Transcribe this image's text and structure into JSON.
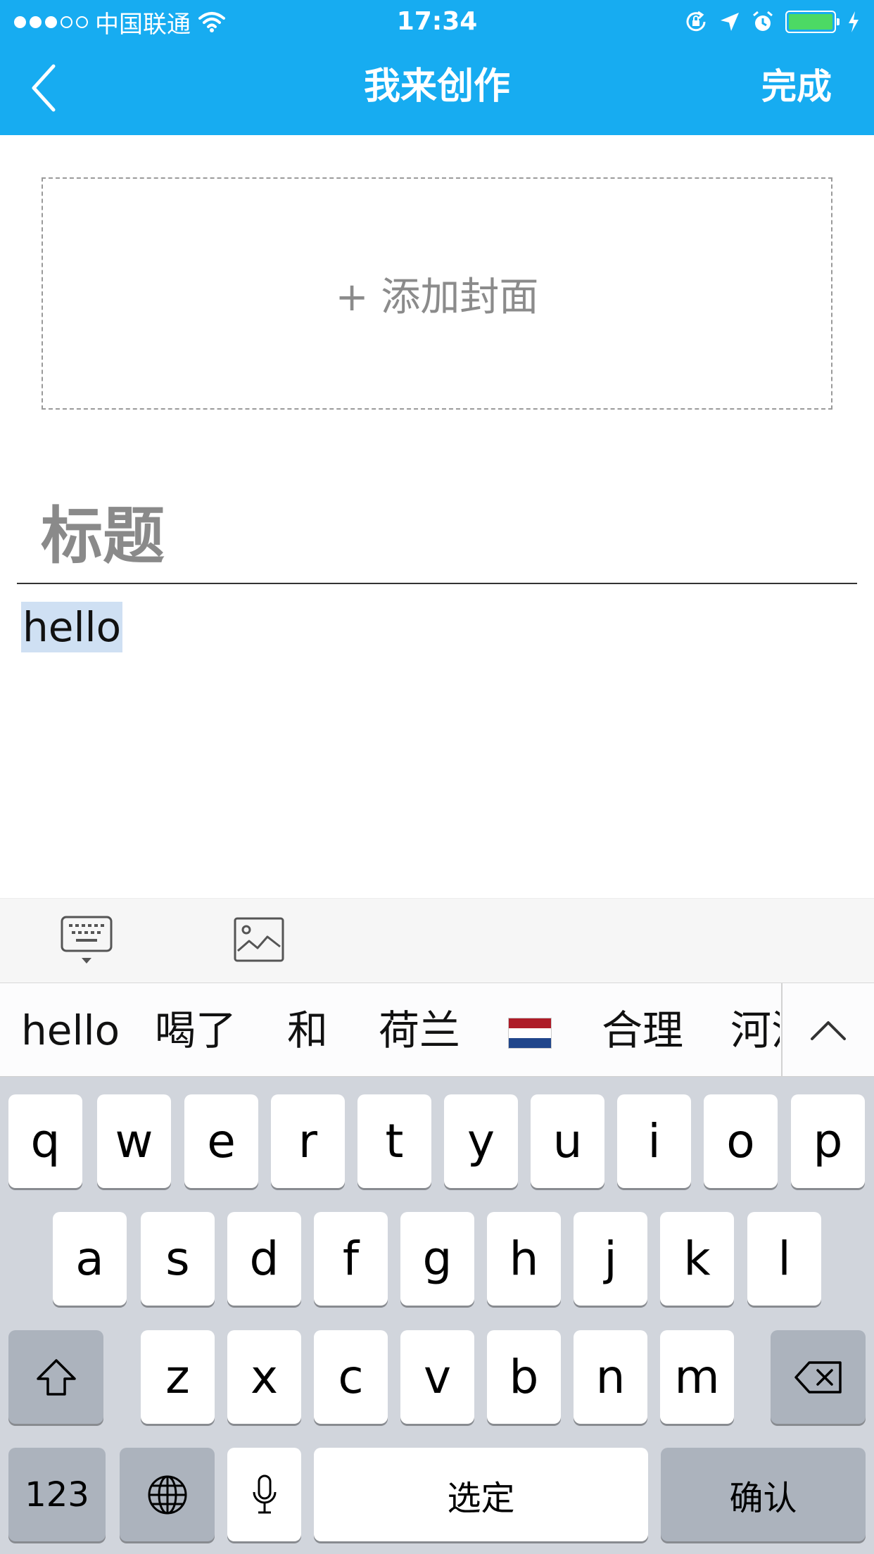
{
  "status_bar": {
    "carrier": "中国联通",
    "time": "17:34",
    "signal_bars_filled": 3,
    "signal_bars_total": 5,
    "battery_level": 1.0
  },
  "nav": {
    "title": "我来创作",
    "done_label": "完成"
  },
  "editor": {
    "cover_label": "+ 添加封面",
    "title_placeholder": "标题",
    "body_text": "hello"
  },
  "toolbar": {
    "icons": [
      "keyboard-toggle-icon",
      "insert-image-icon"
    ]
  },
  "candidates": {
    "items": [
      "hello",
      "喝了",
      "和",
      "荷兰",
      "🇳🇱",
      "合理",
      "河流"
    ]
  },
  "keyboard": {
    "row1": [
      "q",
      "w",
      "e",
      "r",
      "t",
      "y",
      "u",
      "i",
      "o",
      "p"
    ],
    "row2": [
      "a",
      "s",
      "d",
      "f",
      "g",
      "h",
      "j",
      "k",
      "l"
    ],
    "row3": [
      "z",
      "x",
      "c",
      "v",
      "b",
      "n",
      "m"
    ],
    "numbers_label": "123",
    "space_label": "选定",
    "return_label": "确认"
  },
  "colors": {
    "header": "#17acf1",
    "keyboard_bg": "#d1d5dc",
    "function_key": "#acb3bd",
    "selection": "#cfe0f3"
  }
}
